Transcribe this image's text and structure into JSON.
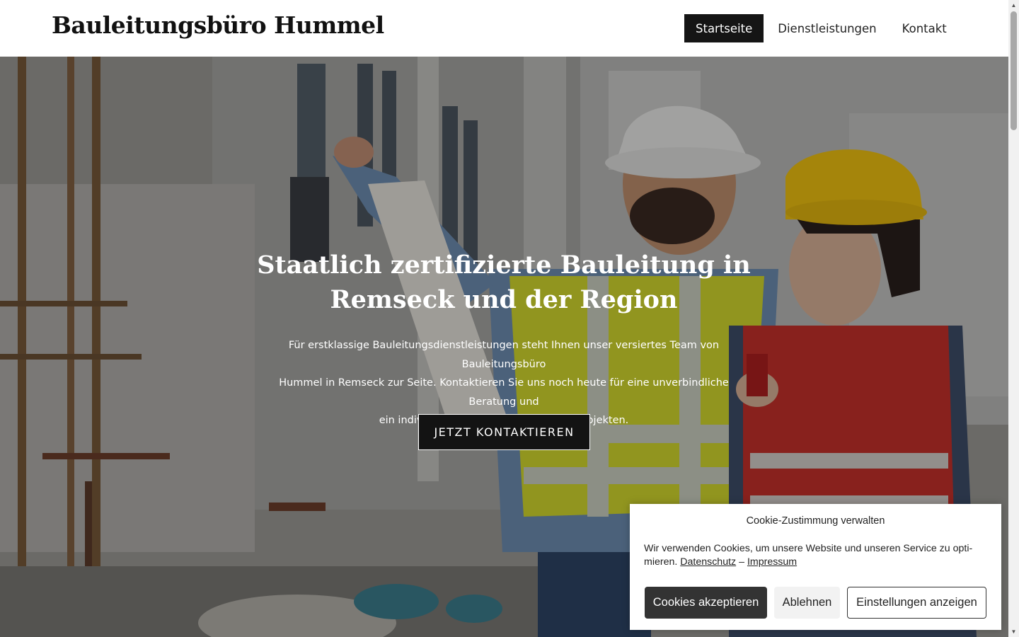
{
  "header": {
    "brand": "Bauleitungsbüro Hummel",
    "nav": [
      {
        "label": "Startseite",
        "active": true
      },
      {
        "label": "Dienstleistungen",
        "active": false
      },
      {
        "label": "Kontakt",
        "active": false
      }
    ]
  },
  "hero": {
    "title_line1": "Staatlich zertifizierte Bauleitung in",
    "title_line2": "Remseck und der Region",
    "text_line1": "Für erstklassige Bauleitungsdienstleistungen steht Ihnen unser versiertes Team von Bauleitungsbüro",
    "text_line2": "Hummel in Remseck zur Seite. Kontaktieren Sie uns noch heute für eine unverbindliche Beratung und",
    "text_line3": "ein individuelles Angebot zu Ihren Bauprojekten.",
    "cta_label": "JETZT KONTAKTIEREN"
  },
  "cookie_banner": {
    "title": "Cookie-Zustimmung verwalten",
    "text_line1": "Wir verwenden Cookies, um unsere Website und unseren Service zu opti-",
    "text_line2_prefix": "mieren.",
    "privacy_link": "Datenschutz",
    "separator": "–",
    "imprint_link": "Impressum",
    "accept_label": "Cookies akzeptieren",
    "deny_label": "Ablehnen",
    "settings_label": "Einstellungen anzeigen"
  },
  "scrollbar": {
    "up_icon": "▲",
    "down_icon": "▼"
  },
  "colors": {
    "dark": "#151515",
    "hero_overlay": "rgba(0,0,0,0.32)",
    "vest_yellow": "#d6dc2f",
    "vest_red": "#c9322c",
    "helmet_yellow": "#f3c511"
  }
}
